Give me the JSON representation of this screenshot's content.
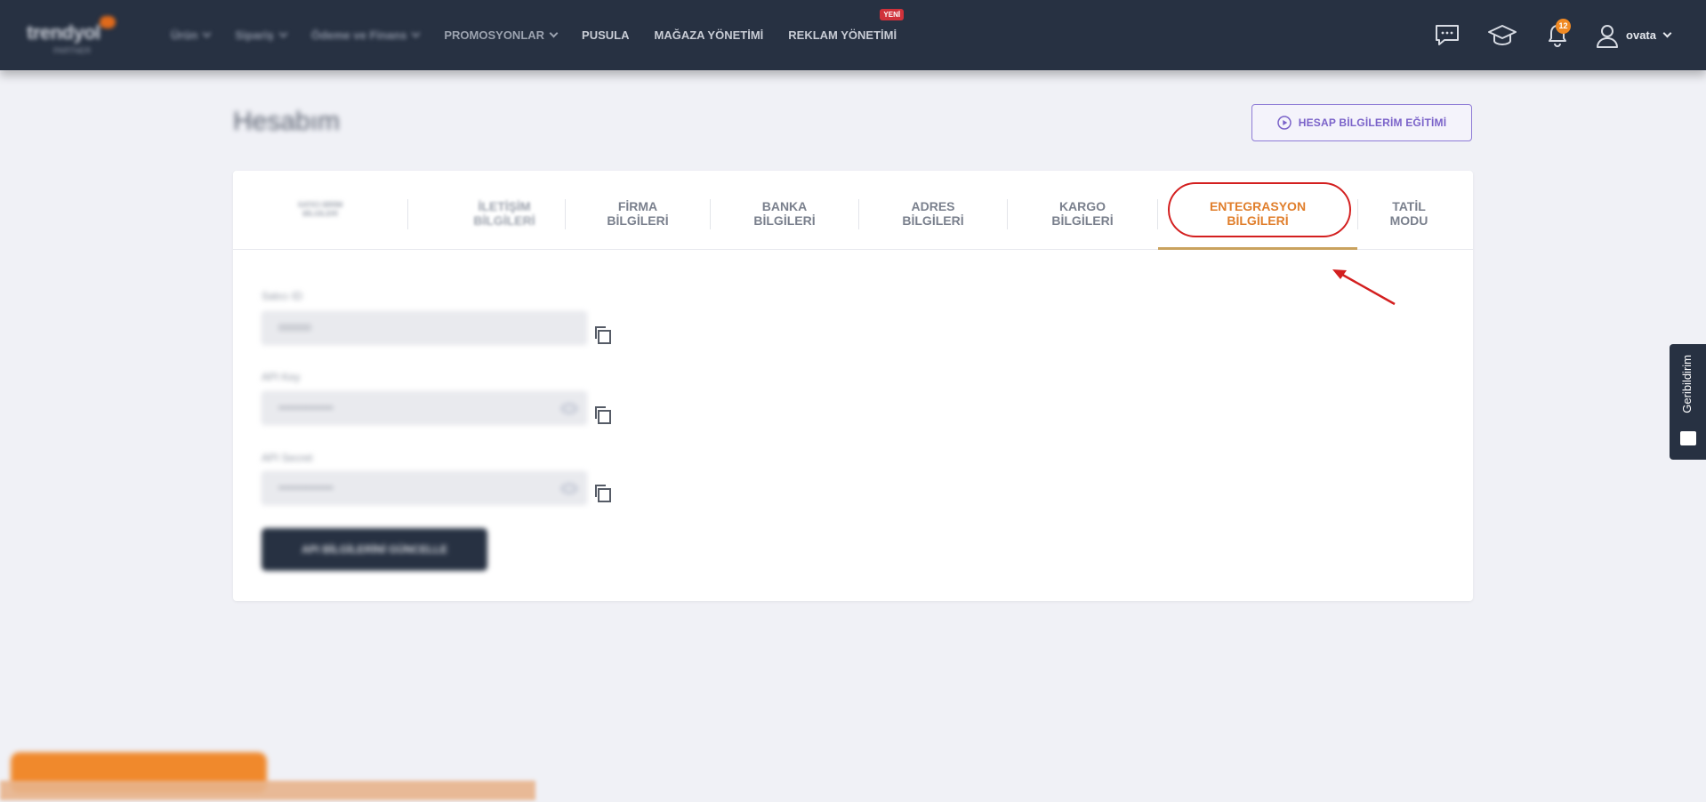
{
  "topbar": {
    "logo_text": "trendyol",
    "logo_sub": "PARTNER",
    "nav": [
      {
        "label": "Ürün",
        "blurred": true,
        "chevron": true
      },
      {
        "label": "Sipariş",
        "blurred": true,
        "chevron": true
      },
      {
        "label": "Ödeme ve Finans",
        "blurred": true,
        "chevron": true
      },
      {
        "label": "PROMOSYONLAR",
        "blurred": false,
        "chevron": true
      },
      {
        "label": "PUSULA",
        "blurred": false,
        "chevron": false
      },
      {
        "label": "MAĞAZA YÖNETİMİ",
        "blurred": false,
        "chevron": false
      },
      {
        "label": "REKLAM YÖNETİMİ",
        "blurred": false,
        "chevron": false,
        "badge": "YENİ"
      }
    ],
    "notification_count": "12",
    "user_name": "ovata"
  },
  "page": {
    "title": "Hesabım",
    "training_button": "HESAP BİLGİLERİM EĞİTİMİ"
  },
  "tabs": [
    {
      "l1": "SATICI BİRİM",
      "l2": "BİLGİLERİ",
      "state": "blur"
    },
    {
      "l1": "İLETİŞİM",
      "l2": "BİLGİLERİ",
      "state": "blur2"
    },
    {
      "l1": "FİRMA",
      "l2": "BİLGİLERİ",
      "state": "normal"
    },
    {
      "l1": "BANKA",
      "l2": "BİLGİLERİ",
      "state": "normal"
    },
    {
      "l1": "ADRES",
      "l2": "BİLGİLERİ",
      "state": "normal"
    },
    {
      "l1": "KARGO",
      "l2": "BİLGİLERİ",
      "state": "normal"
    },
    {
      "l1": "ENTEGRASYON",
      "l2": "BİLGİLERİ",
      "state": "active"
    },
    {
      "l1": "TATİL",
      "l2": "MODU",
      "state": "normal"
    }
  ],
  "form": {
    "seller_id_label": "Satıcı ID",
    "seller_id_value": "000000",
    "api_key_label": "API Key",
    "api_key_value": "••••••••••••••••",
    "api_secret_label": "API Secret",
    "api_secret_value": "••••••••••••••••",
    "update_button": "API BİLGİLERİNİ GÜNCELLE"
  },
  "feedback_tab": "Geribildirim",
  "colors": {
    "topbar": "#273142",
    "active_tab": "#e07e2b",
    "highlight": "#d31f1f",
    "accent_purple": "#7a62c9"
  }
}
